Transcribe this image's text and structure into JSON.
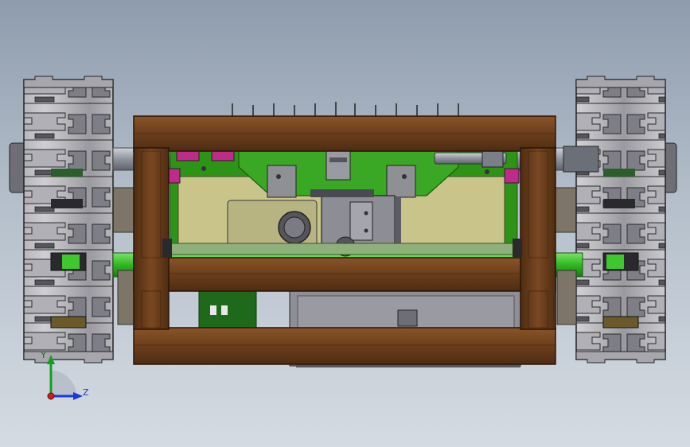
{
  "triad": {
    "y_label": "Y",
    "z_label": "Z",
    "y_color": "#14a01e",
    "z_color": "#1a3ad6",
    "x_color": "#d01e1e"
  },
  "colors": {
    "frame_wood": "#6b3e1c",
    "frame_wood_light": "#8a5428",
    "base_plate": "#c8c48a",
    "green_part": "#2f9a1a",
    "axle_green": "#37c02a",
    "track_gray": "#b9b9bd",
    "metal_gray": "#8f8f96",
    "magenta": "#c02a8a"
  }
}
